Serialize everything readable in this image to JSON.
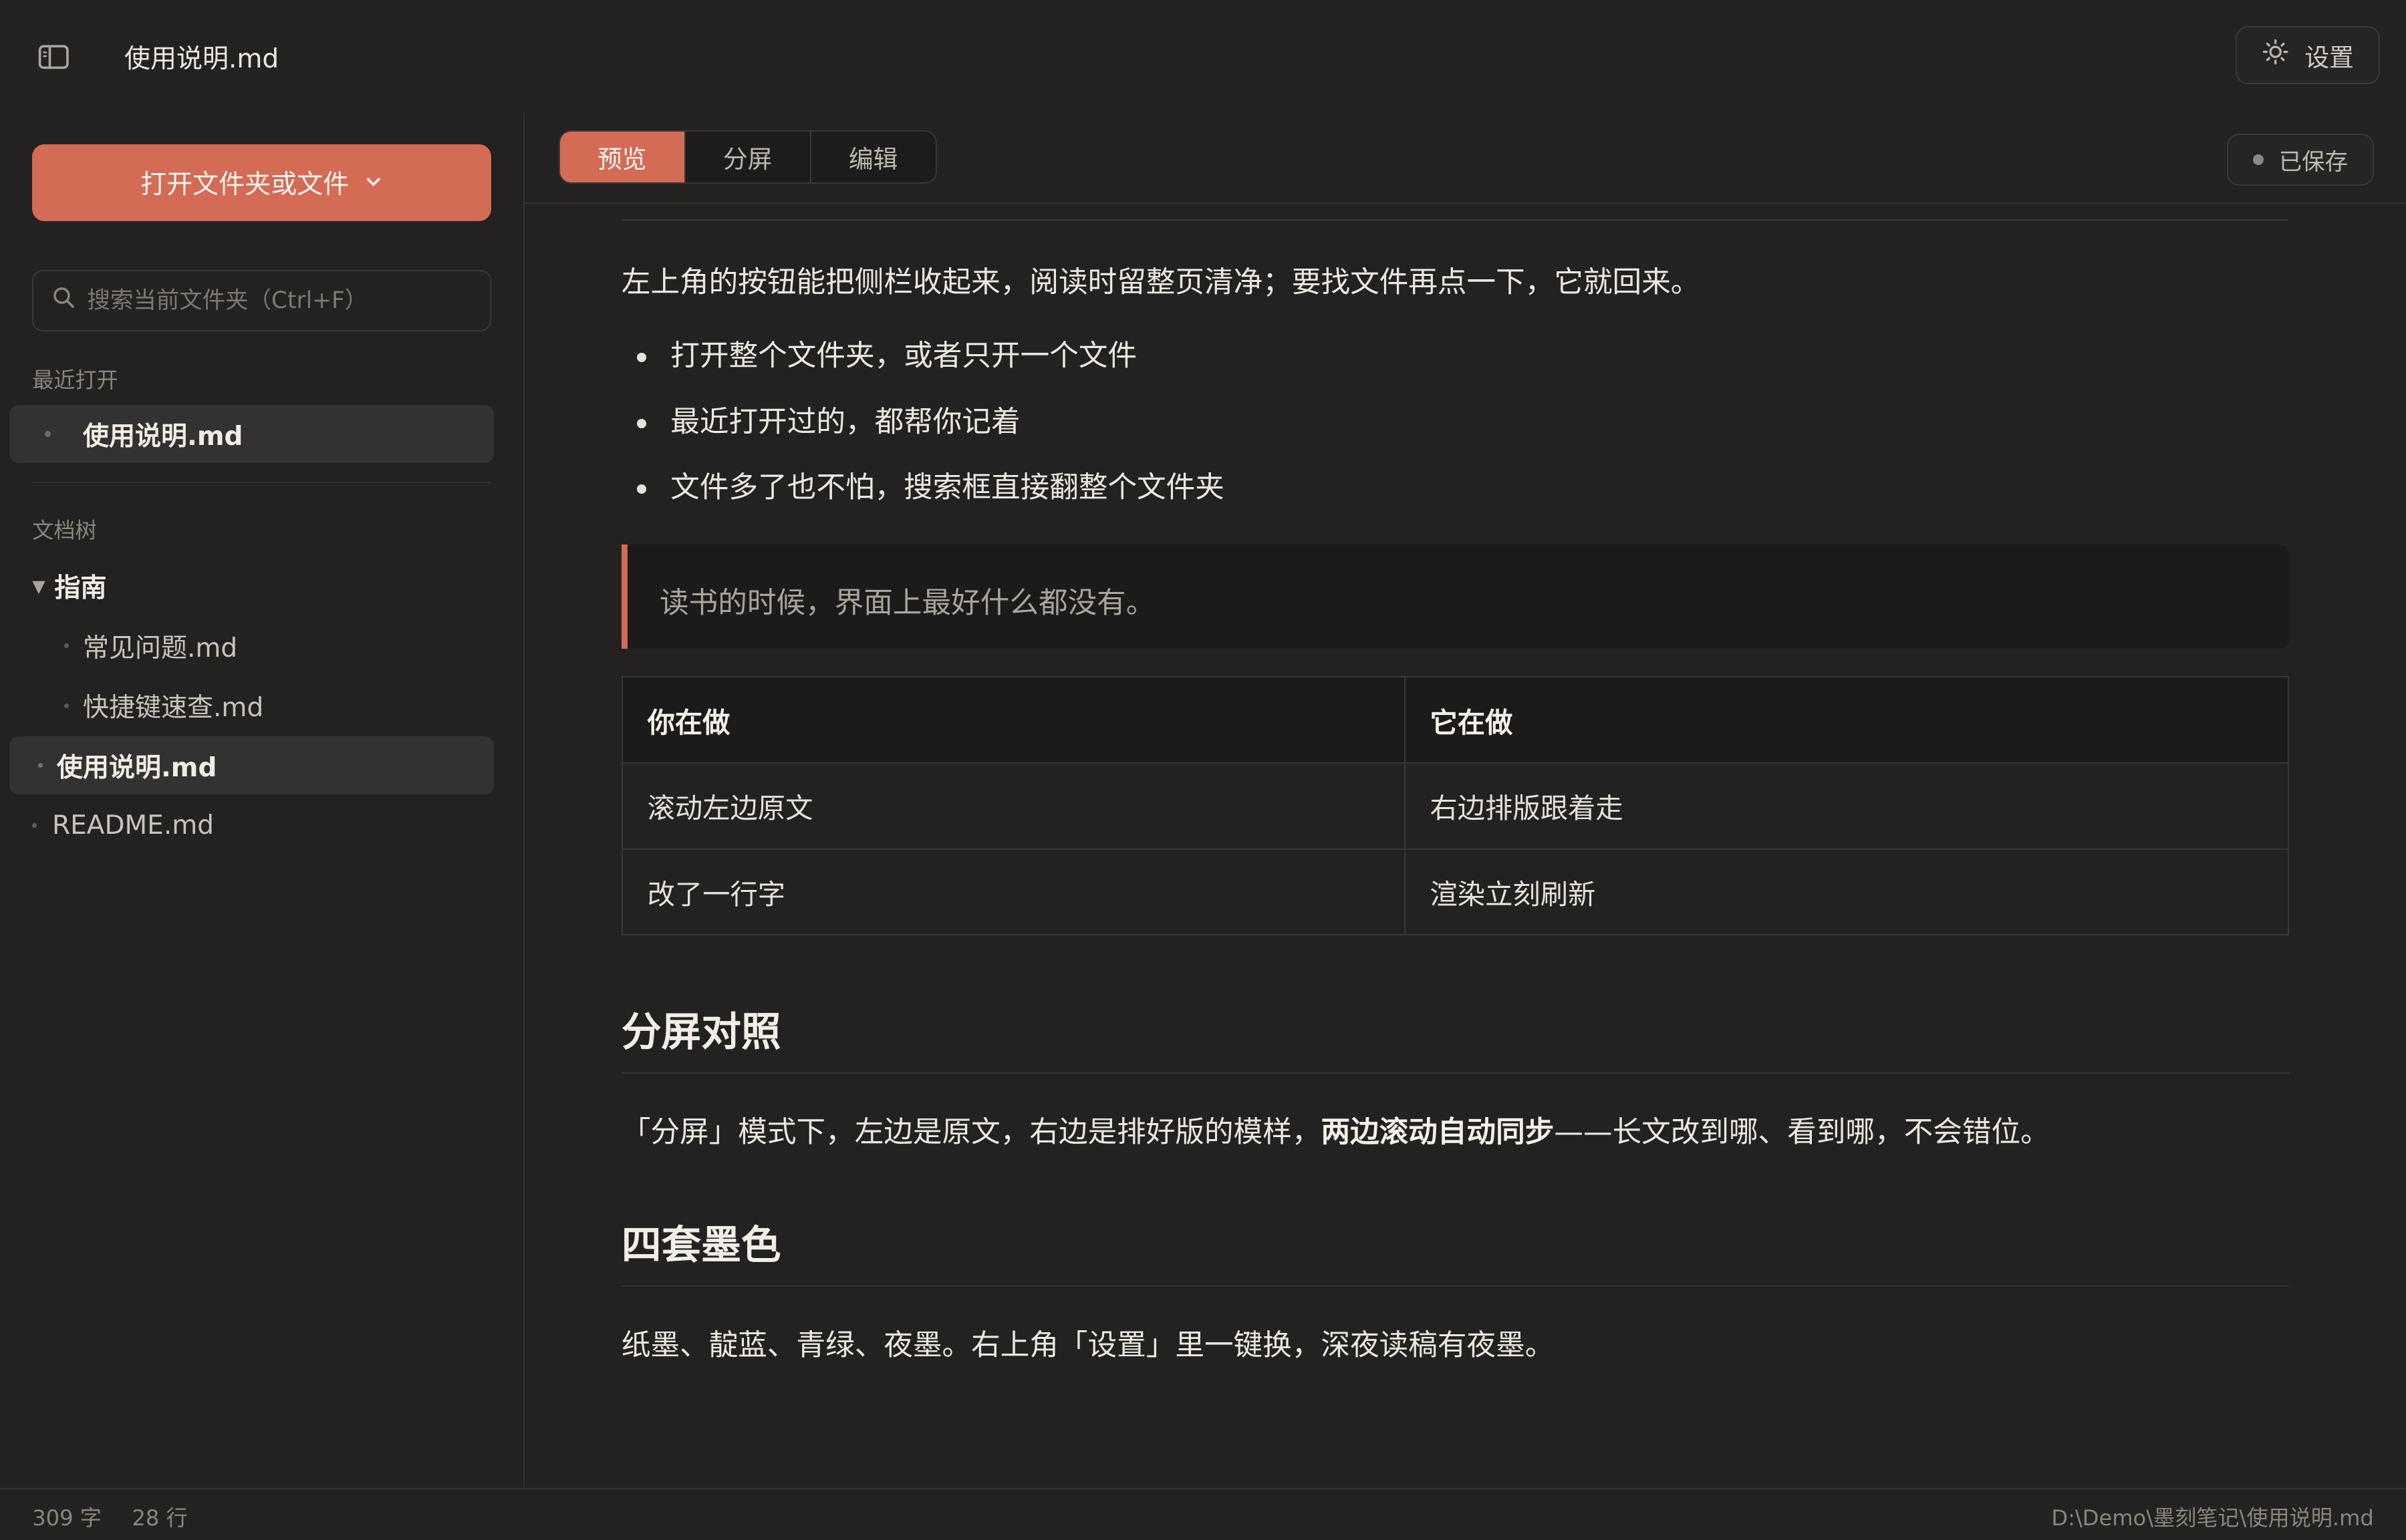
{
  "window": {
    "title": "使用说明.md"
  },
  "settings": {
    "label": "设置",
    "icon": "sun-icon"
  },
  "sidebar": {
    "open_button_label": "打开文件夹或文件",
    "search_placeholder": "搜索当前文件夹（Ctrl+F）",
    "recent_label": "最近打开",
    "recent_items": [
      "使用说明.md"
    ],
    "tree_label": "文档树",
    "tree": {
      "folder": "指南",
      "folder_children": [
        "常见问题.md",
        "快捷键速查.md"
      ],
      "root_files": [
        "使用说明.md",
        "README.md"
      ],
      "active_file": "使用说明.md"
    }
  },
  "view_tabs": [
    {
      "label": "预览",
      "active": true
    },
    {
      "label": "分屏",
      "active": false
    },
    {
      "label": "编辑",
      "active": false
    }
  ],
  "save_status": "已保存",
  "document": {
    "intro": "左上角的按钮能把侧栏收起来，阅读时留整页清净；要找文件再点一下，它就回来。",
    "bullets": [
      "打开整个文件夹，或者只开一个文件",
      "最近打开过的，都帮你记着",
      "文件多了也不怕，搜索框直接翻整个文件夹"
    ],
    "quote": "读书的时候，界面上最好什么都没有。",
    "table": {
      "headers": [
        "你在做",
        "它在做"
      ],
      "rows": [
        [
          "滚动左边原文",
          "右边排版跟着走"
        ],
        [
          "改了一行字",
          "渲染立刻刷新"
        ]
      ]
    },
    "section1_heading": "分屏对照",
    "section1_text_a": "「分屏」模式下，左边是原文，右边是排好版的模样，",
    "section1_text_bold": "两边滚动自动同步",
    "section1_text_b": "——长文改到哪、看到哪，不会错位。",
    "section2_heading": "四套墨色",
    "section2_text": "纸墨、靛蓝、青绿、夜墨。右上角「设置」里一键换，深夜读稿有夜墨。"
  },
  "status": {
    "char_count": "309 字",
    "line_count": "28 行",
    "file_path": "D:\\Demo\\墨刻笔记\\使用说明.md"
  },
  "colors": {
    "accent": "#d36b55",
    "background": "#232221",
    "text": "#ece8e1"
  }
}
